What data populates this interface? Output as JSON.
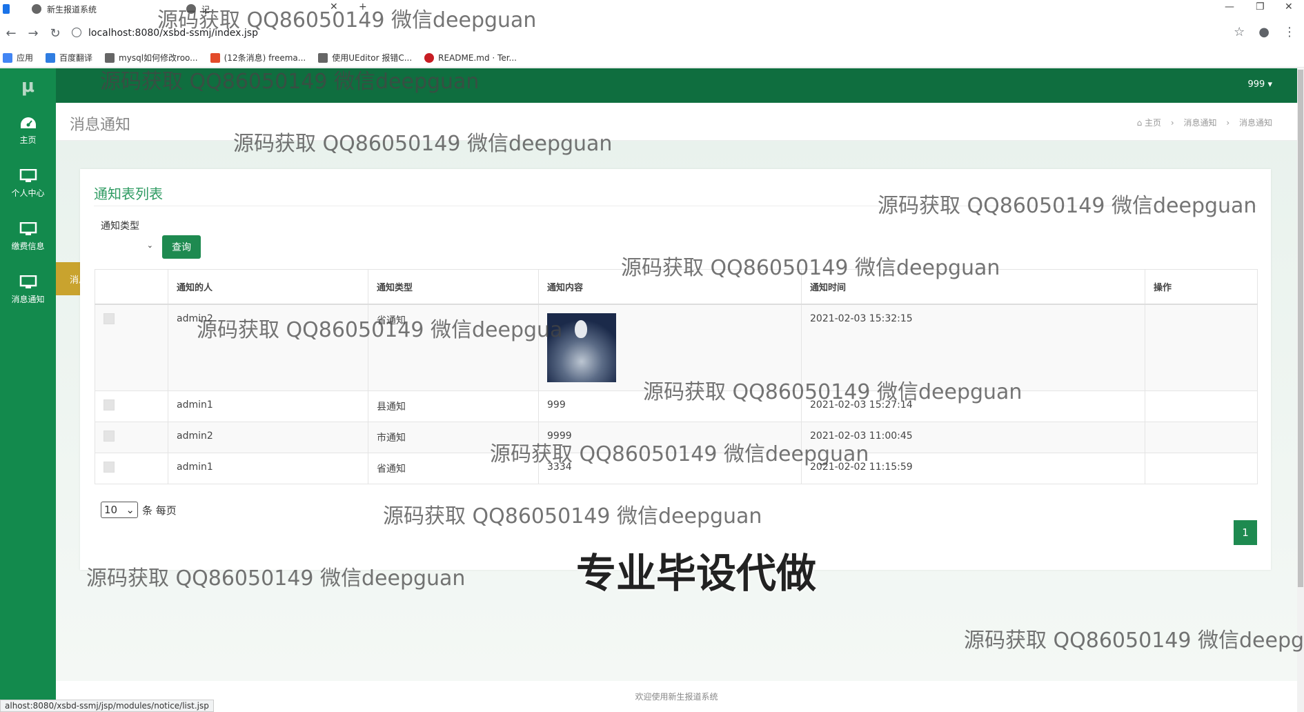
{
  "browser": {
    "tabs": [
      {
        "label": "新生报道系统"
      },
      {
        "label": "记"
      }
    ],
    "url": "localhost:8080/xsbd-ssmj/index.jsp",
    "bookmarks": [
      {
        "label": "应用"
      },
      {
        "label": "百度翻译"
      },
      {
        "label": "mysql如何修改roo..."
      },
      {
        "label": "(12条消息) freema..."
      },
      {
        "label": "使用UEditor 报错C..."
      },
      {
        "label": "README.md · Ter..."
      }
    ],
    "status_url": "alhost:8080/xsbd-ssmj/jsp/modules/notice/list.jsp"
  },
  "app": {
    "logo": "μ",
    "user": "999",
    "sidebar": [
      {
        "label": "主页",
        "icon": "dashboard-icon"
      },
      {
        "label": "个人中心",
        "icon": "monitor-icon"
      },
      {
        "label": "缴费信息",
        "icon": "monitor-icon"
      },
      {
        "label": "消息通知",
        "icon": "monitor-icon"
      }
    ],
    "flyout_item": "消息通知",
    "page_title": "消息通知",
    "breadcrumb": [
      "主页",
      "消息通知",
      "消息通知"
    ],
    "panel_title": "通知表列表",
    "filter": {
      "label": "通知类型",
      "query_button": "查询"
    },
    "table": {
      "headers": [
        "",
        "通知的人",
        "通知类型",
        "通知内容",
        "通知时间",
        "操作"
      ],
      "rows": [
        {
          "person": "admin2",
          "type": "省通知",
          "content": "",
          "time": "2021-02-03 15:32:15",
          "has_image": true
        },
        {
          "person": "admin1",
          "type": "县通知",
          "content": "999",
          "time": "2021-02-03 15:27:14"
        },
        {
          "person": "admin2",
          "type": "市通知",
          "content": "9999",
          "time": "2021-02-03 11:00:45"
        },
        {
          "person": "admin1",
          "type": "省通知",
          "content": "3334",
          "time": "2021-02-02 11:15:59"
        }
      ]
    },
    "page_size": {
      "value": "10",
      "suffix": "条 每页"
    },
    "pagination": {
      "current": "1"
    },
    "footer": "欢迎使用新生报道系统"
  },
  "overlay": {
    "watermark": "源码获取 QQ86050149 微信deepguan",
    "watermark_cut": "源码获取 QQ86050149 微信deepgu",
    "watermark_cut2": "源码获取 QQ86050149 微信deepgua",
    "banner": "专业毕设代做"
  },
  "colors": {
    "sidebar": "#138a4d",
    "topbar": "#0f6e3f",
    "accent": "#1e8a50",
    "flyout": "#c9a32e"
  }
}
